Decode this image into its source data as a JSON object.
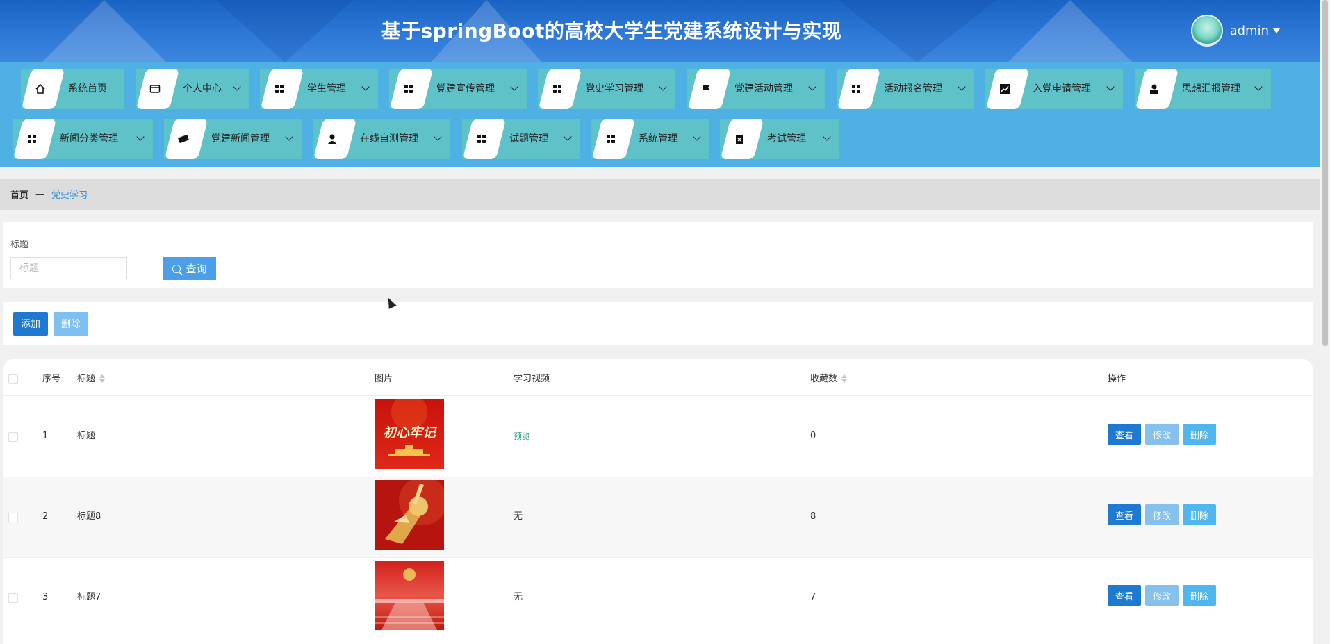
{
  "header": {
    "title": "基于springBoot的高校大学生党建系统设计与实现",
    "username": "admin"
  },
  "nav": {
    "items": [
      {
        "label": "系统首页",
        "icon": "home-icon",
        "has_dropdown": false
      },
      {
        "label": "个人中心",
        "icon": "wallet-icon",
        "has_dropdown": true
      },
      {
        "label": "学生管理",
        "icon": "grid-icon",
        "has_dropdown": true
      },
      {
        "label": "党建宣传管理",
        "icon": "grid-icon",
        "has_dropdown": true
      },
      {
        "label": "党史学习管理",
        "icon": "grid-icon",
        "has_dropdown": true
      },
      {
        "label": "党建活动管理",
        "icon": "flag-icon",
        "has_dropdown": true
      },
      {
        "label": "活动报名管理",
        "icon": "grid-icon",
        "has_dropdown": true
      },
      {
        "label": "入党申请管理",
        "icon": "chart-icon",
        "has_dropdown": true
      },
      {
        "label": "思想汇报管理",
        "icon": "user-icon",
        "has_dropdown": true
      },
      {
        "label": "新闻分类管理",
        "icon": "grid-icon",
        "has_dropdown": true
      },
      {
        "label": "党建新闻管理",
        "icon": "ticket-icon",
        "has_dropdown": true
      },
      {
        "label": "在线自测管理",
        "icon": "person-icon",
        "has_dropdown": true
      },
      {
        "label": "试题管理",
        "icon": "grid-icon",
        "has_dropdown": true
      },
      {
        "label": "系统管理",
        "icon": "grid-icon",
        "has_dropdown": true
      },
      {
        "label": "考试管理",
        "icon": "clipboard-icon",
        "has_dropdown": true
      }
    ]
  },
  "breadcrumb": {
    "home": "首页",
    "separator": "—",
    "current": "党史学习"
  },
  "search": {
    "label": "标题",
    "placeholder": "标题",
    "button": "查询"
  },
  "actions": {
    "add": "添加",
    "delete": "删除"
  },
  "table": {
    "headers": {
      "index": "序号",
      "title": "标题",
      "image": "图片",
      "video": "学习视频",
      "favorites": "收藏数",
      "ops": "操作"
    },
    "rows": [
      {
        "index": "1",
        "title": "标题",
        "video": "预览",
        "video_is_link": true,
        "favorites": "0",
        "image_text": "初心牢记"
      },
      {
        "index": "2",
        "title": "标题8",
        "video": "无",
        "video_is_link": false,
        "favorites": "8"
      },
      {
        "index": "3",
        "title": "标题7",
        "video": "无",
        "video_is_link": false,
        "favorites": "7"
      }
    ],
    "op_labels": {
      "view": "查看",
      "edit": "修改",
      "delete": "删除"
    }
  },
  "colors": {
    "header_bg": "#2f7ad8",
    "nav_bg": "#4fb0e4",
    "nav_item_bg": "#5fc2c9",
    "primary": "#1e7ad1",
    "link_green": "#16a47a"
  }
}
